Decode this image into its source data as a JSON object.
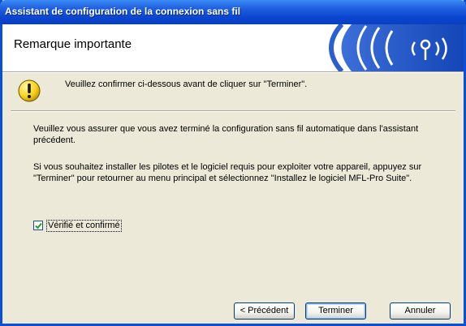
{
  "window": {
    "title": "Assistant de configuration de la connexion sans fil"
  },
  "header": {
    "title": "Remarque importante",
    "logo_icon": "wireless-waves-icon"
  },
  "warning": {
    "icon": "warning-exclamation-icon",
    "text": "Veuillez confirmer ci-dessous avant de cliquer sur \"Terminer\"."
  },
  "body": {
    "paragraph1": "Veuillez vous assurer que vous avez terminé la configuration sans fil automatique dans l'assistant précédent.",
    "paragraph2": "Si vous souhaitez installer les pilotes et le logiciel requis pour exploiter votre appareil, appuyez sur \"Terminer\" pour retourner au menu principal et sélectionnez \"Installez le logiciel MFL-Pro Suite\"."
  },
  "checkbox": {
    "label": "Vérifié et confirmé",
    "checked": true
  },
  "buttons": {
    "back": "< Précédent",
    "finish": "Terminer",
    "cancel": "Annuler"
  },
  "colors": {
    "title_bar": "#0a4fd6",
    "dialog_bg": "#ece9d8",
    "logo_blue": "#1e5ccf"
  }
}
